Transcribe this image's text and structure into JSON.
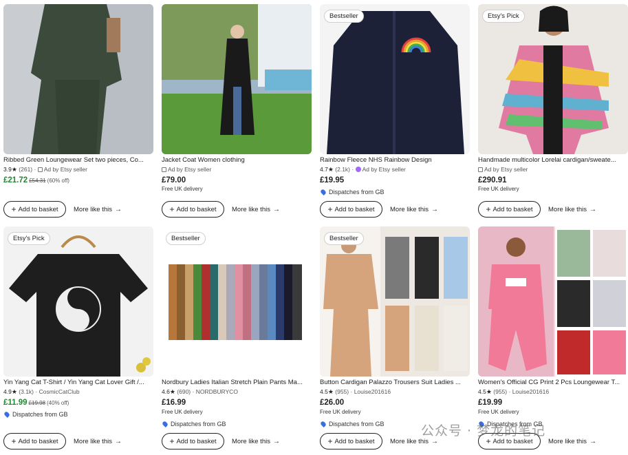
{
  "listings": [
    {
      "title": "Ribbed Green Loungewear Set two pieces, Co...",
      "rating": "3.9",
      "reviews": "(261)",
      "seller": "Ad by Etsy seller",
      "price": "£21.72",
      "original_price": "£54.31",
      "discount": "(60% off)",
      "sale": true,
      "badge": "",
      "delivery": "",
      "dispatch": "",
      "basket": "Add to basket",
      "more": "More like this"
    },
    {
      "title": "Jacket Coat Women clothing",
      "rating": "",
      "reviews": "",
      "seller": "Ad by Etsy seller",
      "price": "£79.00",
      "original_price": "",
      "discount": "",
      "sale": false,
      "badge": "",
      "delivery": "Free UK delivery",
      "dispatch": "",
      "basket": "Add to basket",
      "more": "More like this"
    },
    {
      "title": "Rainbow Fleece NHS Rainbow Design",
      "rating": "4.7",
      "reviews": "(2.1k)",
      "seller": "Ad by Etsy seller",
      "price": "£19.95",
      "original_price": "",
      "discount": "",
      "sale": false,
      "badge": "Bestseller",
      "delivery": "",
      "dispatch": "Dispatches from GB",
      "basket": "Add to basket",
      "more": "More like this"
    },
    {
      "title": "Handmade multicolor Lorelai cardigan/sweate...",
      "rating": "",
      "reviews": "",
      "seller": "Ad by Etsy seller",
      "price": "£290.91",
      "original_price": "",
      "discount": "",
      "sale": false,
      "badge": "Etsy's Pick",
      "delivery": "Free UK delivery",
      "dispatch": "",
      "basket": "Add to basket",
      "more": "More like this"
    },
    {
      "title": "Yin Yang Cat T-Shirt / Yin Yang Cat Lover Gift /...",
      "rating": "4.9",
      "reviews": "(3.1k)",
      "seller": "CosmicCatClub",
      "price": "£11.99",
      "original_price": "£19.98",
      "discount": "(40% off)",
      "sale": true,
      "badge": "Etsy's Pick",
      "delivery": "",
      "dispatch": "Dispatches from GB",
      "basket": "Add to basket",
      "more": "More like this"
    },
    {
      "title": "Nordbury Ladies Italian Stretch Plain Pants Ma...",
      "rating": "4.6",
      "reviews": "(690)",
      "seller": "NORDBURYCO",
      "price": "£16.99",
      "original_price": "",
      "discount": "",
      "sale": false,
      "badge": "Bestseller",
      "delivery": "Free UK delivery",
      "dispatch": "Dispatches from GB",
      "basket": "Add to basket",
      "more": "More like this"
    },
    {
      "title": "Button Cardigan Palazzo Trousers Suit Ladies ...",
      "rating": "4.5",
      "reviews": "(955)",
      "seller": "Louise201616",
      "price": "£26.00",
      "original_price": "",
      "discount": "",
      "sale": false,
      "badge": "Bestseller",
      "delivery": "Free UK delivery",
      "dispatch": "Dispatches from GB",
      "basket": "Add to basket",
      "more": "More like this"
    },
    {
      "title": "Women's Official CG Print 2 Pcs Loungewear T...",
      "rating": "4.5",
      "reviews": "(955)",
      "seller": "Louise201616",
      "price": "£19.99",
      "original_price": "",
      "discount": "",
      "sale": false,
      "badge": "",
      "delivery": "Free UK delivery",
      "dispatch": "Dispatches from GB",
      "basket": "Add to basket",
      "more": "More like this"
    }
  ],
  "watermark": "公众号 · 梦龙的笔记",
  "colors": {
    "sale_green": "#258635",
    "pin_blue": "#3a6de0",
    "text": "#222222"
  }
}
